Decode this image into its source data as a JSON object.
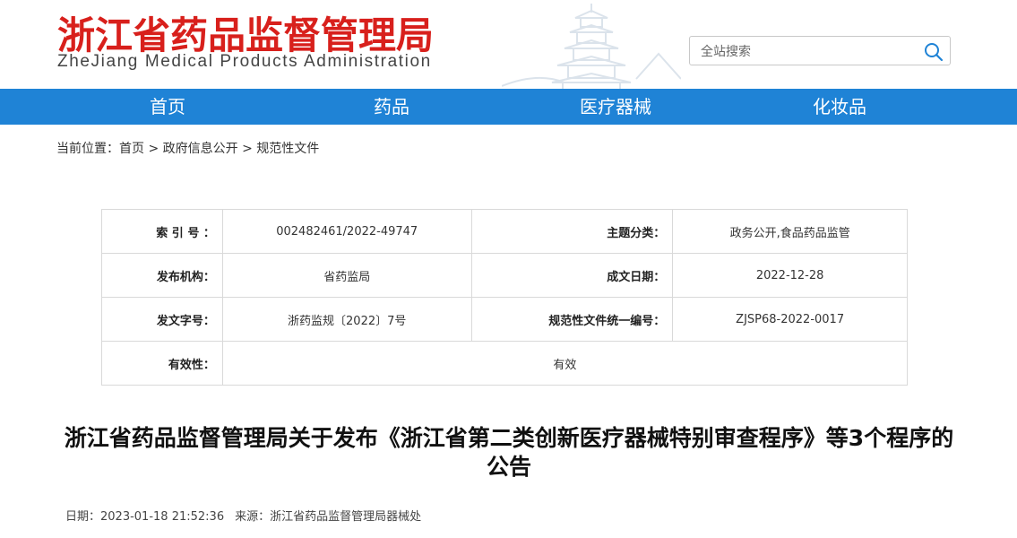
{
  "header": {
    "logo_cn": "浙江省药品监督管理局",
    "logo_en": "ZheJiang Medical Products Administration"
  },
  "search": {
    "placeholder": "全站搜索"
  },
  "nav": [
    {
      "label": "首页"
    },
    {
      "label": "药品"
    },
    {
      "label": "医疗器械"
    },
    {
      "label": "化妆品"
    }
  ],
  "breadcrumb": {
    "prefix": "当前位置：",
    "items": [
      "首页",
      "政府信息公开",
      "规范性文件"
    ],
    "separator": ">"
  },
  "meta_table": {
    "rows": [
      {
        "k1": "索 引 号 ：",
        "v1": "002482461/2022-49747",
        "k2": "主题分类：",
        "v2": "政务公开,食品药品监管"
      },
      {
        "k1": "发布机构：",
        "v1": "省药监局",
        "k2": "成文日期：",
        "v2": "2022-12-28"
      },
      {
        "k1": "发文字号：",
        "v1": "浙药监规〔2022〕7号",
        "k2": "规范性文件统一编号：",
        "v2": "ZJSP68-2022-0017"
      }
    ],
    "validity": {
      "k": "有效性：",
      "v": "有效"
    }
  },
  "article": {
    "title": "浙江省药品监督管理局关于发布《浙江省第二类创新医疗器械特别审查程序》等3个程序的公告",
    "date_label": "日期：",
    "date": "2023-01-18 21:52:36",
    "source_label": "来源：",
    "source": "浙江省药品监督管理局器械处"
  },
  "colors": {
    "brand_red": "#d8201c",
    "nav_blue": "#1f83d6"
  }
}
